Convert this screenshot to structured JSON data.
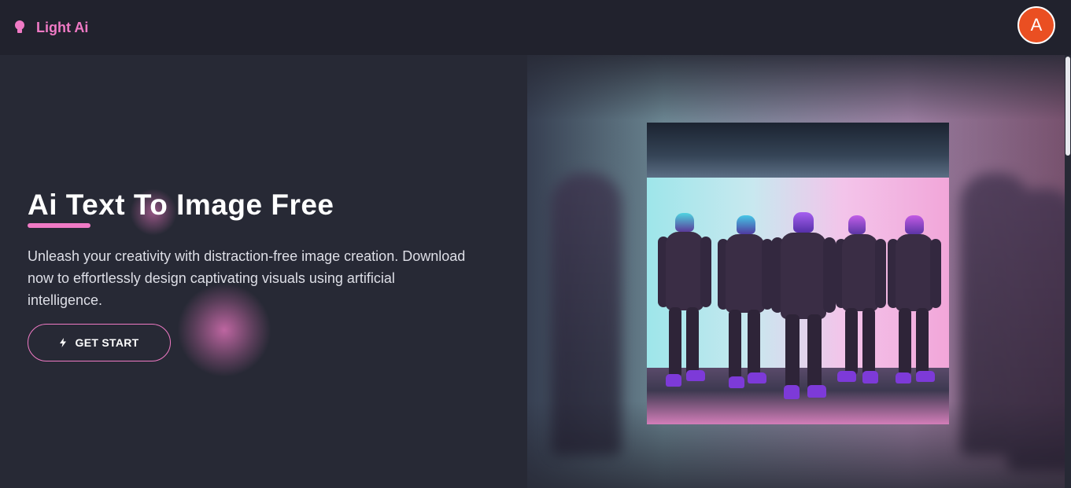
{
  "header": {
    "brand_name": "Light Ai",
    "brand_icon": "lightbulb-icon",
    "avatar_initial": "A"
  },
  "hero": {
    "title": "Ai Text To Image Free",
    "description": "Unleash your creativity with distraction-free image creation. Download now to effortlessly design captivating visuals using artificial intelligence.",
    "cta_label": "GET START",
    "cta_icon": "lightning-bolt-icon"
  },
  "colors": {
    "accent": "#f07ac5",
    "background": "#272935",
    "topbar": "#21222d",
    "avatar": "#ea4f22"
  }
}
